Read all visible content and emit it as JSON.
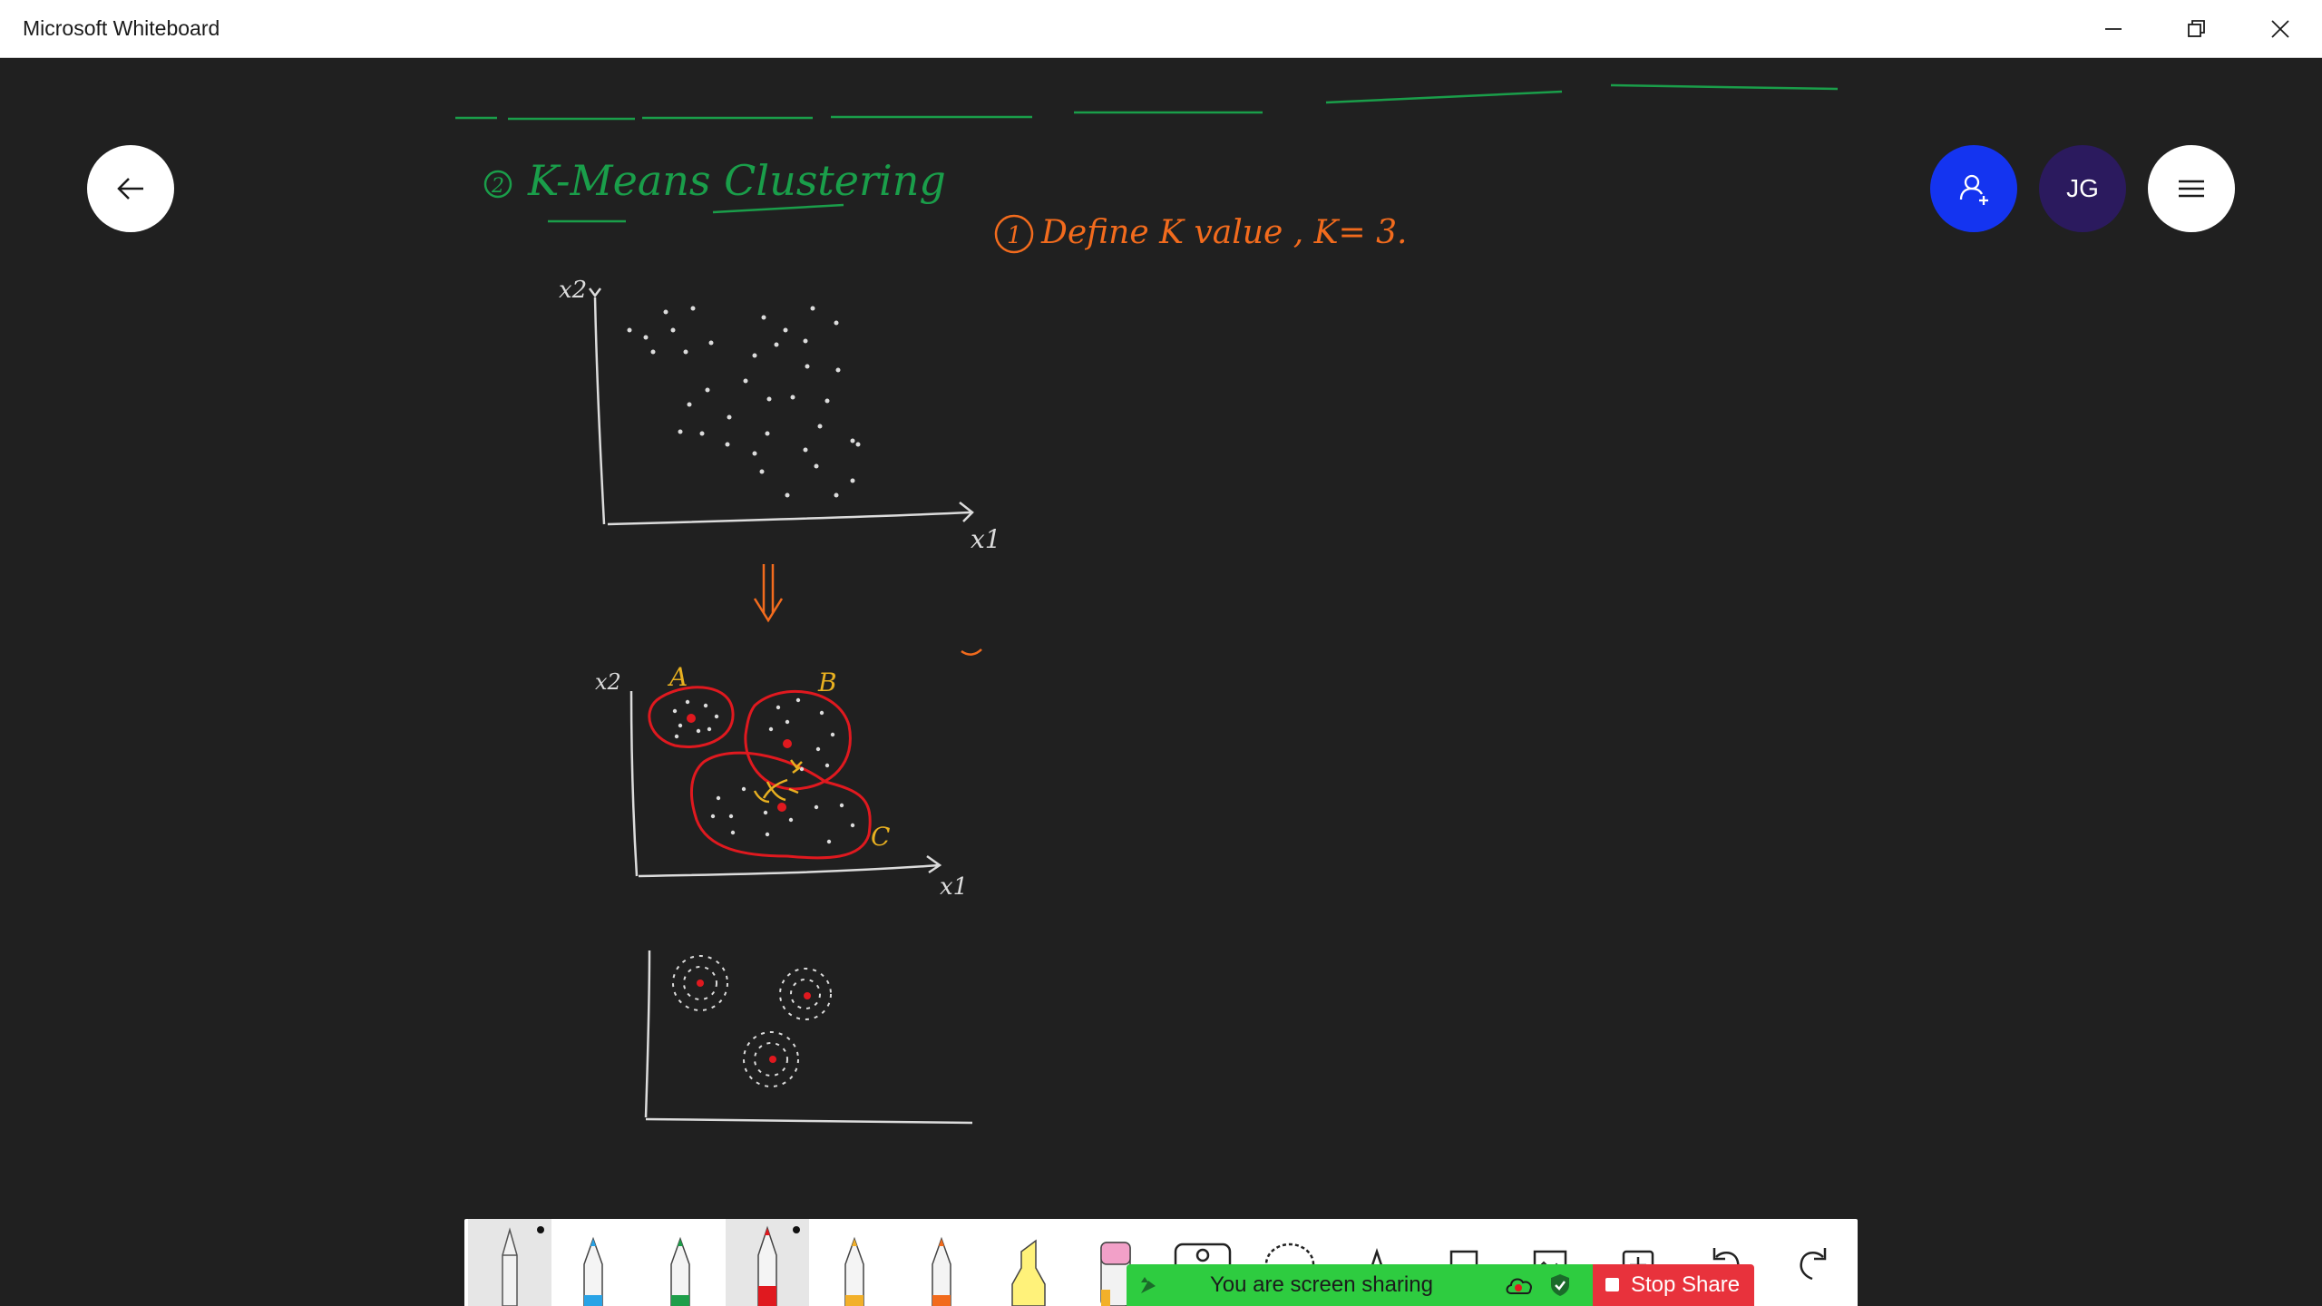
{
  "window": {
    "title": "Microsoft Whiteboard"
  },
  "board": {
    "heading": "K-Means Clustering",
    "heading_number": "2",
    "step_text": "Define K value , K= 3.",
    "step_number": "1",
    "axis_y_label": "x2",
    "axis_x_label": "x1",
    "cluster_labels": [
      "A",
      "B",
      "C"
    ]
  },
  "header_buttons": {
    "avatar_initials": "JG"
  },
  "toolbar": {
    "tools": [
      {
        "name": "pen-white",
        "color": "#ffffff"
      },
      {
        "name": "pen-blue",
        "color": "#29a3e6"
      },
      {
        "name": "pen-green",
        "color": "#1e9e4a"
      },
      {
        "name": "pen-red",
        "color": "#e0191f"
      },
      {
        "name": "pen-yellow",
        "color": "#f2b02a"
      },
      {
        "name": "pen-orange",
        "color": "#f26b1d"
      },
      {
        "name": "highlighter",
        "color": "#fff27a"
      },
      {
        "name": "eraser",
        "color": "#f2a0c8"
      },
      {
        "name": "ruler"
      },
      {
        "name": "lasso"
      },
      {
        "name": "shapes"
      },
      {
        "name": "note"
      },
      {
        "name": "image"
      },
      {
        "name": "add"
      },
      {
        "name": "undo"
      },
      {
        "name": "redo"
      }
    ]
  },
  "share_bar": {
    "status": "You are screen sharing",
    "stop_label": "Stop Share"
  },
  "colors": {
    "canvas": "#202020",
    "ink_green": "#1a9e4a",
    "ink_orange": "#f26b1d",
    "ink_red": "#e0191f",
    "ink_yellow": "#e8b020",
    "accent_blue": "#1434f0",
    "share_green": "#2ecc40",
    "share_red": "#e8323c"
  }
}
